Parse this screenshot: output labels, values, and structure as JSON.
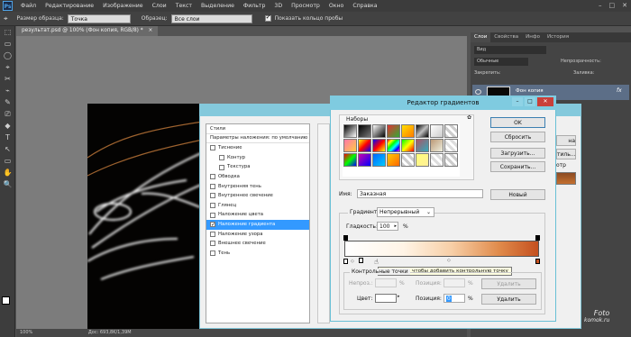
{
  "app": {
    "logo": "Ps",
    "menu": [
      "Файл",
      "Редактирование",
      "Изображение",
      "Слои",
      "Текст",
      "Выделение",
      "Фильтр",
      "3D",
      "Просмотр",
      "Окно",
      "Справка"
    ],
    "window_controls": [
      "–",
      "□",
      "✕"
    ]
  },
  "options": {
    "size_label": "Размер образца:",
    "size_value": "Точка",
    "sample_label": "Образец:",
    "sample_value": "Все слои",
    "ring_label": "Показать кольцо пробы"
  },
  "document": {
    "tab": "результат.psd @ 100% (Фон копия, RGB/8) *",
    "close": "×",
    "status": "Дос: 693,8K/1,39M",
    "zoom": "100%"
  },
  "tools": [
    "⬚",
    "▭",
    "◯",
    "⌖",
    "✂",
    "⌁",
    "✎",
    "⎚",
    "◆",
    "T",
    "↖",
    "▭",
    "✋",
    "🔍"
  ],
  "right": {
    "tabs": [
      "Слои",
      "Свойства",
      "Инфо",
      "История"
    ],
    "kind": "Вид",
    "mode": "Обычные",
    "opacity": "Непрозрачность:",
    "lock": "Закрепить:",
    "fill": "Заливка:",
    "layer_name": "Фон копия",
    "fx": "fx"
  },
  "styles": {
    "items": [
      {
        "label": "Стили",
        "type": "header"
      },
      {
        "label": "Параметры наложения: по умолчанию",
        "type": "header"
      },
      {
        "label": "Тиснение",
        "type": "check"
      },
      {
        "label": "Контур",
        "type": "sub"
      },
      {
        "label": "Текстура",
        "type": "sub"
      },
      {
        "label": "Обводка",
        "type": "check"
      },
      {
        "label": "Внутренняя тень",
        "type": "check"
      },
      {
        "label": "Внутреннее свечение",
        "type": "check"
      },
      {
        "label": "Глянец",
        "type": "check"
      },
      {
        "label": "Наложение цвета",
        "type": "check"
      },
      {
        "label": "Наложение градиента",
        "type": "check",
        "selected": true
      },
      {
        "label": "Наложение узора",
        "type": "check"
      },
      {
        "label": "Внешнее свечение",
        "type": "check"
      },
      {
        "label": "Тень",
        "type": "check"
      }
    ],
    "right_fragments": [
      "на",
      "тиль...",
      "отр"
    ]
  },
  "gradient_editor": {
    "title": "Редактор градиентов",
    "ok": "OK",
    "reset": "Сбросить",
    "load": "Загрузить...",
    "save": "Сохранить...",
    "presets_label": "Наборы",
    "gear": "✿",
    "name_label": "Имя:",
    "name_value": "Заказная",
    "new": "Новый",
    "type_label": "Градиент:",
    "type_value": "Непрерывный",
    "smooth_label": "Гладкость:",
    "smooth_value": "100",
    "pct": "%",
    "stops_label": "Контрольные точки",
    "opacity_label": "Непроз.:",
    "loc_label": "Позиция:",
    "delete": "Удалить",
    "color_label": "Цвет:",
    "loc_value": "0",
    "tooltip": "Щелкните, чтобы добавить контрольную точку",
    "colors": {
      "end": "#c4501f"
    }
  },
  "watermark": {
    "line1": "Foto",
    "line2": "komok.ru"
  }
}
